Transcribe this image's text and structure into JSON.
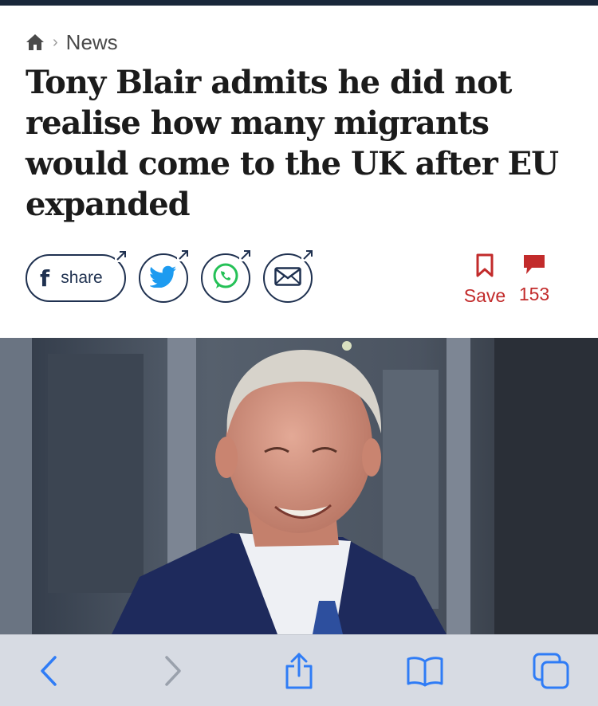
{
  "breadcrumb": {
    "home_icon": "home-icon",
    "separator": "›",
    "section": "News"
  },
  "headline": "Tony Blair admits he did not realise how many migrants would come to the UK after EU expanded",
  "share": {
    "facebook_label": "share",
    "icons": [
      "facebook-icon",
      "twitter-icon",
      "whatsapp-icon",
      "email-icon",
      "external-arrow-icon"
    ]
  },
  "actions": {
    "save_label": "Save",
    "comment_count": "153"
  },
  "colors": {
    "navy": "#1f3150",
    "accent_red": "#c22b2b",
    "toolbar_bg": "#d7dbe3",
    "ios_blue": "#2f7cf6"
  },
  "toolbar": {
    "icons": [
      "back-icon",
      "forward-icon",
      "share-icon",
      "bookmarks-icon",
      "tabs-icon"
    ]
  }
}
